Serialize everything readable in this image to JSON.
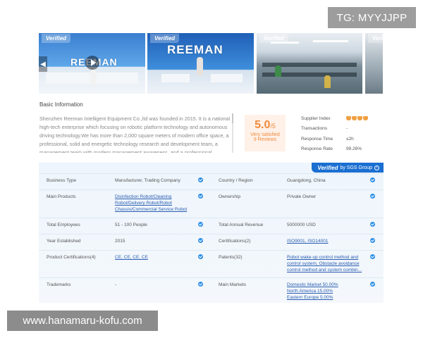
{
  "watermarks": {
    "top": "TG: MYYJJPP",
    "bottom": "www.hanamaru-kofu.com"
  },
  "gallery": {
    "verified_label": "Verified",
    "brand_text": "REEMAN",
    "thumb_count": 4
  },
  "basic_info": {
    "title": "Basic Information",
    "intro": "Shenzhen Reeman Intelligent Equipment Co.,ltd was founded in 2015. It is a national high-tech enterprise which focusing on robotic platform technology and autonomous driving technology.We has more than 2,000 square meters of modern office space, a professional, solid and energetic technology research and development team, a management team with modern management awareness, and a professional",
    "rating": {
      "score": "5.0",
      "out_of": "/5",
      "label": "Very satisfied",
      "reviews": "9 Reviews"
    },
    "stats": [
      {
        "label": "Supplier Index",
        "value": ""
      },
      {
        "label": "Transactions",
        "value": "-"
      },
      {
        "label": "Response Time",
        "value": "≤2h"
      },
      {
        "label": "Response Rate",
        "value": "99.26%"
      }
    ],
    "supplier_index_diamonds": 4
  },
  "verified": {
    "badge_main": "Verified",
    "badge_sub": "by SGS Group",
    "rows": [
      {
        "label1": "Business Type",
        "value1": [
          "Manufacturer, Trading Company"
        ],
        "link1": false,
        "label2": "Country / Region",
        "value2": [
          "Guangdong, China"
        ],
        "link2": false
      },
      {
        "label1": "Main Products",
        "value1": [
          "Disinfection Robot/Cleaning",
          "Robot/Delivery Robot/Robot",
          "Chassis/Commercial Service Robot"
        ],
        "link1": true,
        "label2": "Ownership",
        "value2": [
          "Private Owner"
        ],
        "link2": false
      },
      {
        "label1": "Total Employees",
        "value1": [
          "51 - 100 People"
        ],
        "link1": false,
        "label2": "Total Annual Revenue",
        "value2": [
          "5000000 USD"
        ],
        "link2": false
      },
      {
        "label1": "Year Established",
        "value1": [
          "2015"
        ],
        "link1": false,
        "label2": "Certifications(2)",
        "value2": [
          "ISO9001, ISO14001"
        ],
        "link2": true
      },
      {
        "label1": "Product Certifications(4)",
        "value1": [
          "CE, CE, CE, CE"
        ],
        "link1": true,
        "label2": "Patents(32)",
        "value2": [
          "Robot wake-up control method and",
          "control system, Obstacle avoidance",
          "control method and system combin..."
        ],
        "link2": true
      },
      {
        "label1": "Trademarks",
        "value1": [
          "-"
        ],
        "link1": false,
        "label2": "Main Markets",
        "value2": [
          "Domestic Market 50.00%",
          "North America 15.00%",
          "Eastern Europe 5.00%"
        ],
        "link2": true
      }
    ]
  }
}
